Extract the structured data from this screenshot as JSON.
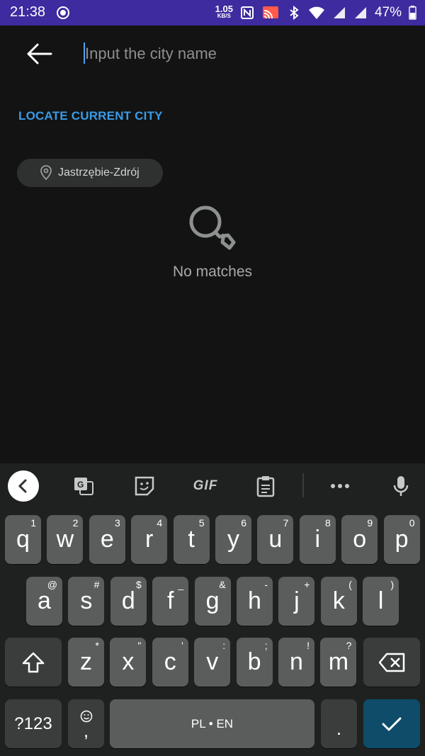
{
  "status_bar": {
    "time": "21:38",
    "net_speed_value": "1.05",
    "net_speed_unit": "KB/S",
    "battery": "47%",
    "icons": [
      "record-icon",
      "nfc-icon",
      "cast-icon",
      "bluetooth-icon",
      "wifi-icon",
      "signal-icon",
      "signal-icon",
      "battery-icon"
    ],
    "background": "#3d2b9f"
  },
  "search": {
    "placeholder": "Input the city name",
    "value": ""
  },
  "locate_label": "LOCATE CURRENT CITY",
  "recent_city": "Jastrzębie-Zdrój",
  "empty_state": {
    "text": "No matches",
    "icon": "search-icon"
  },
  "keyboard": {
    "toolbar": {
      "gif_label": "GIF",
      "icons": [
        "chevron-left-icon",
        "translate-icon",
        "sticker-icon",
        "gif-icon",
        "clipboard-icon",
        "more-icon",
        "mic-icon"
      ]
    },
    "row1": [
      {
        "label": "q",
        "hint": "1"
      },
      {
        "label": "w",
        "hint": "2"
      },
      {
        "label": "e",
        "hint": "3"
      },
      {
        "label": "r",
        "hint": "4"
      },
      {
        "label": "t",
        "hint": "5"
      },
      {
        "label": "y",
        "hint": "6"
      },
      {
        "label": "u",
        "hint": "7"
      },
      {
        "label": "i",
        "hint": "8"
      },
      {
        "label": "o",
        "hint": "9"
      },
      {
        "label": "p",
        "hint": "0"
      }
    ],
    "row2": [
      {
        "label": "a",
        "hint": "@"
      },
      {
        "label": "s",
        "hint": "#"
      },
      {
        "label": "d",
        "hint": "$"
      },
      {
        "label": "f",
        "hint": "_"
      },
      {
        "label": "g",
        "hint": "&"
      },
      {
        "label": "h",
        "hint": "-"
      },
      {
        "label": "j",
        "hint": "+"
      },
      {
        "label": "k",
        "hint": "("
      },
      {
        "label": "l",
        "hint": ")"
      }
    ],
    "row3": [
      {
        "label": "z",
        "hint": "*"
      },
      {
        "label": "x",
        "hint": "\""
      },
      {
        "label": "c",
        "hint": "'"
      },
      {
        "label": "v",
        "hint": ":"
      },
      {
        "label": "b",
        "hint": ";"
      },
      {
        "label": "n",
        "hint": "!"
      },
      {
        "label": "m",
        "hint": "?"
      }
    ],
    "symbols_label": "?123",
    "comma_label": ",",
    "space_label": "PL • EN",
    "period_label": ".",
    "accent_color": "#0e4c6a"
  }
}
